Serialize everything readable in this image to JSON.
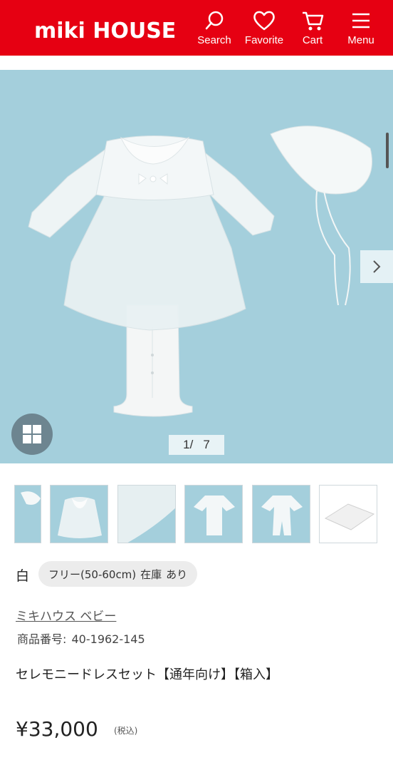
{
  "header": {
    "logo": "miki HOUSE",
    "brand_color": "#e60012",
    "nav": [
      {
        "label": "Search",
        "icon": "search-icon"
      },
      {
        "label": "Favorite",
        "icon": "heart-icon"
      },
      {
        "label": "Cart",
        "icon": "cart-icon"
      },
      {
        "label": "Menu",
        "icon": "menu-icon"
      }
    ]
  },
  "gallery": {
    "current": "1/",
    "total": "7",
    "background_color": "#9fccd9",
    "next_icon": "chevron-right-icon",
    "grid_icon": "grid-icon"
  },
  "thumbnails": [
    {
      "label": "bonnet-crop"
    },
    {
      "label": "dress-front"
    },
    {
      "label": "lace-detail"
    },
    {
      "label": "coverall-front"
    },
    {
      "label": "coverall-alt"
    },
    {
      "label": "gift-box"
    }
  ],
  "product": {
    "color": "白",
    "size_chip": {
      "size": "フリー(50-60cm)",
      "stock_label": "在庫",
      "stock_value": "あり"
    },
    "brand": "ミキハウス ベビー",
    "product_no_label": "商品番号:",
    "product_no": "40-1962-145",
    "title": "セレモニードレスセット【通年向け】【箱入】",
    "price": "¥33,000",
    "tax_note": "(税込)"
  }
}
